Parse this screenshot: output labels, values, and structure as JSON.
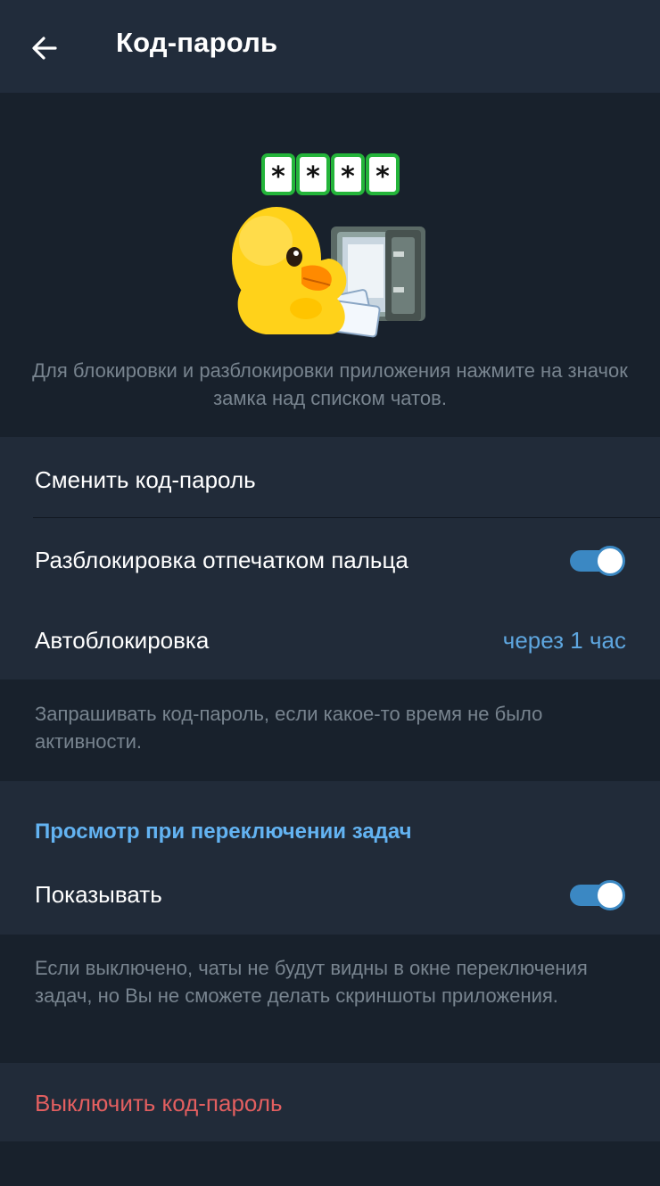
{
  "header": {
    "title": "Код-пароль",
    "back_icon": "arrow-left-icon"
  },
  "hero": {
    "sticker": "duck-with-safe-sticker",
    "pin_chars": [
      "*",
      "*",
      "*",
      "*"
    ],
    "description": "Для блокировки и разблокировки приложения нажмите на значок замка над списком чатов."
  },
  "settings": {
    "change_passcode_label": "Сменить код-пароль",
    "fingerprint_label": "Разблокировка отпечатком пальца",
    "fingerprint_enabled": true,
    "autolock_label": "Автоблокировка",
    "autolock_value": "через 1 час",
    "autolock_hint": "Запрашивать код-пароль, если какое-то время не было активности."
  },
  "task_switcher": {
    "header": "Просмотр при переключении задач",
    "show_label": "Показывать",
    "show_enabled": true,
    "hint": "Если выключено, чаты не будут видны в окне переключения задач, но Вы не сможете делать скриншоты приложения."
  },
  "disable_passcode_label": "Выключить код-пароль",
  "colors": {
    "background": "#18212c",
    "section": "#212b39",
    "accent": "#5ea6df",
    "toggle": "#3b88c3",
    "danger": "#e35f60",
    "hint_text": "#78848f"
  }
}
